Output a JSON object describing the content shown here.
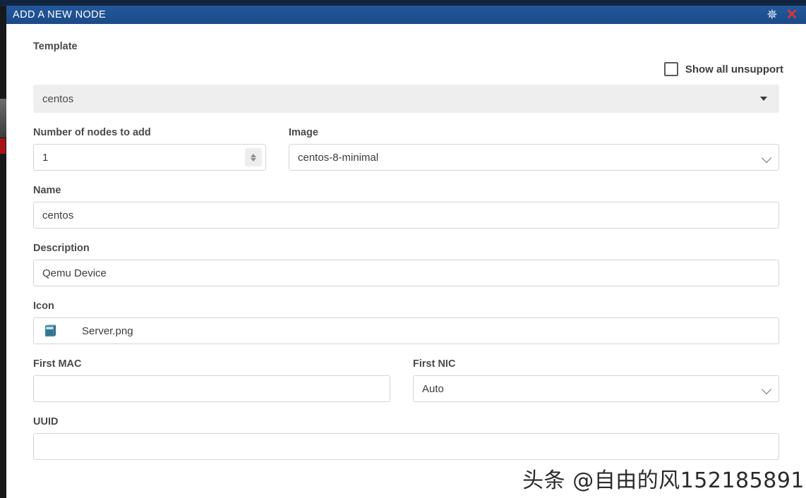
{
  "window": {
    "title": "ADD A NEW NODE",
    "gear_icon": "gear-icon",
    "close_icon": "close-icon",
    "title_bar_color": "#1d4e8f",
    "close_icon_color": "#e03232"
  },
  "form": {
    "template": {
      "label": "Template",
      "value": "centos",
      "caret_icon": "chevron-down-icon"
    },
    "show_unsupported": {
      "label": "Show all unsupport",
      "checked": false
    },
    "nodes_to_add": {
      "label": "Number of nodes to add",
      "value": "1"
    },
    "image": {
      "label": "Image",
      "value": "centos-8-minimal"
    },
    "name": {
      "label": "Name",
      "value": "centos"
    },
    "description": {
      "label": "Description",
      "value": "Qemu Device"
    },
    "icon": {
      "label": "Icon",
      "icon_name": "server-icon",
      "filename": "Server.png"
    },
    "first_mac": {
      "label": "First MAC",
      "value": "",
      "placeholder": ""
    },
    "first_nic": {
      "label": "First NIC",
      "value": "Auto"
    },
    "uuid": {
      "label": "UUID",
      "value": "",
      "placeholder": ""
    }
  },
  "watermark": {
    "text": "头条 @自由的风152185891"
  }
}
